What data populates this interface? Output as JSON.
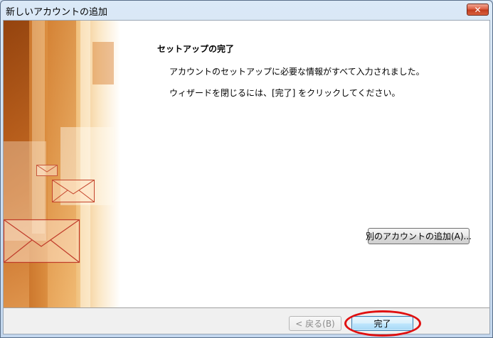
{
  "window": {
    "title": "新しいアカウントの追加",
    "close_label": "✕"
  },
  "page": {
    "heading": "セットアップの完了",
    "line1": "アカウントのセットアップに必要な情報がすべて入力されました。",
    "line2": "ウィザードを閉じるには、[完了] をクリックしてください。"
  },
  "buttons": {
    "add_account": "別のアカウントの追加(A)...",
    "back": "< 戻る(B)",
    "finish": "完了"
  },
  "colors": {
    "highlight": "#e01010",
    "banner_accent": "#d98a3c"
  }
}
